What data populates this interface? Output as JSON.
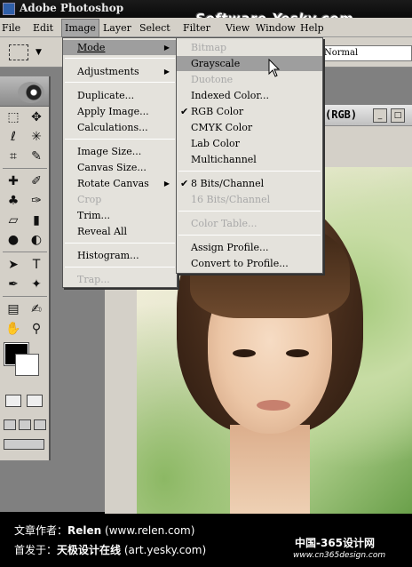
{
  "window": {
    "title": "Adobe Photoshop"
  },
  "watermark_top": "Software.Yesky.com",
  "menubar": [
    "File",
    "Edit",
    "Image",
    "Layer",
    "Select",
    "Filter",
    "View",
    "Window",
    "Help"
  ],
  "options": {
    "blend_mode": "Normal"
  },
  "document": {
    "title_suffix": "(RGB)",
    "minimize": "_",
    "maximize": "□"
  },
  "image_menu": [
    {
      "label": "Mode",
      "submenu": true,
      "highlight": true
    },
    {
      "label": "Adjustments",
      "submenu": true
    },
    {
      "label": "Duplicate..."
    },
    {
      "label": "Apply Image..."
    },
    {
      "label": "Calculations..."
    },
    {
      "label": "Image Size..."
    },
    {
      "label": "Canvas Size..."
    },
    {
      "label": "Rotate Canvas",
      "submenu": true
    },
    {
      "label": "Crop",
      "disabled": true
    },
    {
      "label": "Trim..."
    },
    {
      "label": "Reveal All"
    },
    {
      "label": "Histogram..."
    },
    {
      "label": "Trap...",
      "disabled": true
    }
  ],
  "mode_menu": [
    {
      "label": "Bitmap",
      "disabled": true
    },
    {
      "label": "Grayscale",
      "highlight": true
    },
    {
      "label": "Duotone",
      "disabled": true
    },
    {
      "label": "Indexed Color..."
    },
    {
      "label": "RGB Color",
      "checked": true
    },
    {
      "label": "CMYK Color"
    },
    {
      "label": "Lab Color"
    },
    {
      "label": "Multichannel"
    },
    {
      "label": "8 Bits/Channel",
      "checked": true
    },
    {
      "label": "16 Bits/Channel",
      "disabled": true
    },
    {
      "label": "Color Table...",
      "disabled": true
    },
    {
      "label": "Assign Profile..."
    },
    {
      "label": "Convert to Profile..."
    }
  ],
  "caption": {
    "author_label": "文章作者：",
    "author_name": "Relen",
    "author_url": "(www.relen.com)",
    "first_label": "首发于：",
    "first_site": "天极设计在线",
    "first_url": "(art.yesky.com)",
    "logo_text": "中国-365设计网",
    "logo_url": "www.cn365design.com"
  },
  "colors": {
    "menu_bg": "#e4e2dc",
    "highlight": "#9e9e9e",
    "toolbar": "#d4d0c8"
  }
}
